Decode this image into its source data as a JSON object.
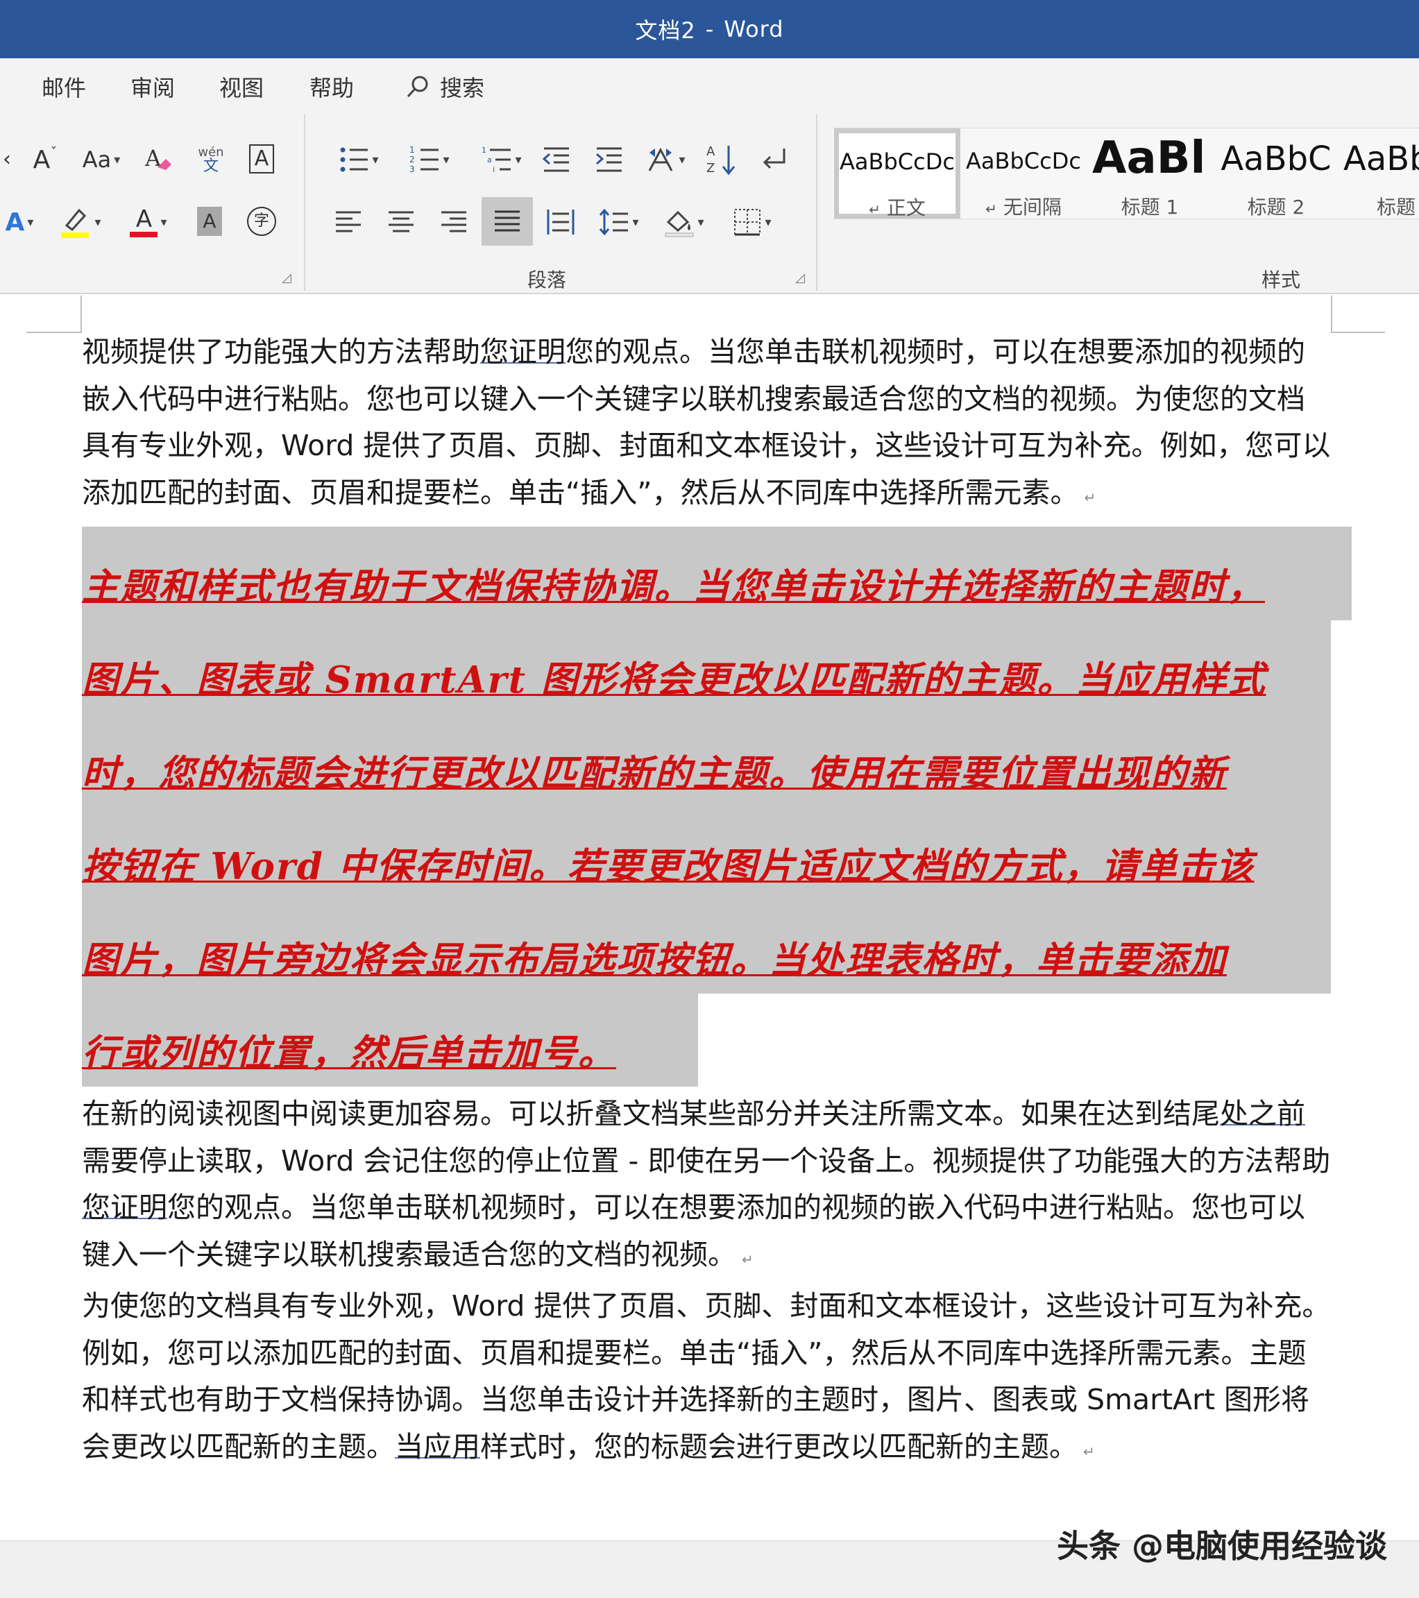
{
  "window": {
    "doc_name": "文档2",
    "separator": "-",
    "app_name": "Word"
  },
  "tabs": [
    "邮件",
    "审阅",
    "视图",
    "帮助"
  ],
  "search": {
    "label": "搜索"
  },
  "ribbon": {
    "paragraph_group_label": "段落",
    "styles_group_label": "样式",
    "phonetic_top": "wén",
    "phonetic_bottom": "文",
    "font_case_label": "Aa",
    "grow_font_label": "A",
    "shade_char_label": "A",
    "enclose_char_label": "字",
    "char_border_label": "A",
    "font_color_label": "A",
    "text_effects_label": "A"
  },
  "styles": [
    {
      "preview": "AaBbCcDc",
      "name": "正文",
      "mark": "↵",
      "selected": true
    },
    {
      "preview": "AaBbCcDc",
      "name": "无间隔",
      "mark": "↵"
    },
    {
      "preview": "AaBl",
      "name": "标题 1"
    },
    {
      "preview": "AaBbC",
      "name": "标题 2"
    },
    {
      "preview": "AaBb",
      "name": "标题"
    }
  ],
  "colors": {
    "title_bar": "#2b579a",
    "highlight": "#ffff00",
    "font_color": "#e81123",
    "selected_text": "#d01010",
    "selection_bg": "#c8c8c8"
  },
  "document": {
    "para1": {
      "before": "视频提供了功能强大的方法帮助",
      "squiggle": "您证明",
      "after": "您的观点。当您单击联机视频时，可以在想要添加的视频的嵌入代码中进行粘贴。您也可以键入一个关键字以联机搜索最适合您的文档的视频。为使您的文档具有专业外观，Word 提供了页眉、页脚、封面和文本框设计，这些设计可互为补充。例如，您可以添加匹配的封面、页眉和提要栏。单击“插入”，然后从不同库中选择所需元素。"
    },
    "selected_lines": [
      "主题和样式也有助于文档保持协调。当您单击设计并选择新的主题时，",
      "图片、图表或 SmartArt 图形将会更改以匹配新的主题。当应用样式",
      "时，您的标题会进行更改以匹配新的主题。使用在需要位置出现的新",
      "按钮在 Word 中保存时间。若要更改图片适应文档的方式，请单击该",
      "图片，图片旁边将会显示布局选项按钮。当处理表格时，单击要添加",
      "行或列的位置，然后单击加号。"
    ],
    "para3": {
      "before": "在新的阅读视图中阅读更加容易。可以折叠文档某些部分并关注所需文本。如果在达到结尾",
      "squiggle1": "处之前",
      "middle": "需要停止读取，Word 会记住您的停止位置 - 即使在另一个设备上。视频提供了功能强大的方法帮助",
      "squiggle2": "您证明",
      "after": "您的观点。当您单击联机视频时，可以在想要添加的视频的嵌入代码中进行粘贴。您也可以键入一个关键字以联机搜索最适合您的文档的视频。"
    },
    "para4": {
      "before": "为使您的文档具有专业外观，Word 提供了页眉、页脚、封面和文本框设计，这些设计可互为补充。例如，您可以添加匹配的封面、页眉和提要栏。单击“插入”，然后从不同库中选择所需元素。主题和样式也有助于文档保持协调。当您单击设计并选择新的主题时，图片、图表或 SmartArt 图形将会更改以匹配新的主题。",
      "squiggle": "当应用",
      "after": "样式时，您的标题会进行更改以匹配新的主题。"
    },
    "paragraph_mark": "↵"
  },
  "watermark": "头条 @电脑使用经验谈"
}
